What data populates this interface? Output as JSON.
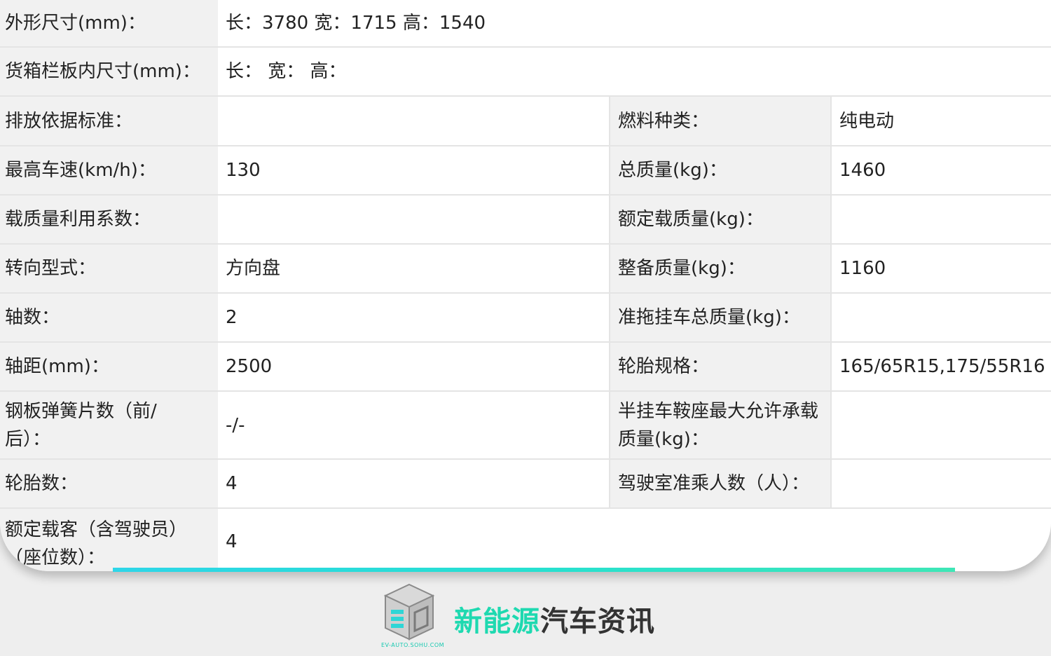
{
  "rows": [
    {
      "label": "外形尺寸(mm)：",
      "value": "长：3780 宽：1715 高：1540"
    },
    {
      "label": "货箱栏板内尺寸(mm)：",
      "value": "长： 宽： 高："
    },
    {
      "label": "排放依据标准：",
      "value": "",
      "label2": "燃料种类：",
      "value2": "纯电动"
    },
    {
      "label": "最高车速(km/h)：",
      "value": "130",
      "label2": "总质量(kg)：",
      "value2": "1460"
    },
    {
      "label": "载质量利用系数：",
      "value": "",
      "label2": "额定载质量(kg)：",
      "value2": ""
    },
    {
      "label": "转向型式：",
      "value": "方向盘",
      "label2": "整备质量(kg)：",
      "value2": "1160"
    },
    {
      "label": "轴数：",
      "value": "2",
      "label2": "准拖挂车总质量(kg)：",
      "value2": ""
    },
    {
      "label": "轴距(mm)：",
      "value": "2500",
      "label2": "轮胎规格：",
      "value2": "165/65R15,175/55R16"
    },
    {
      "label": "钢板弹簧片数（前/后）：",
      "value": "-/-",
      "label2": "半挂车鞍座最大允许承载质量(kg)：",
      "value2": ""
    },
    {
      "label": "轮胎数：",
      "value": "4",
      "label2": "驾驶室准乘人数（人）：",
      "value2": ""
    },
    {
      "label": "额定载客（含驾驶员）（座位数）：",
      "value": "4"
    }
  ],
  "brand": {
    "name_part1": "新能源",
    "name_part2": "汽车资讯",
    "domain": "EV-AUTO.SOHU.COM",
    "logo_icon": "cube-logo-icon",
    "colors": {
      "accent": "#1ed9b0",
      "text": "#333333"
    }
  }
}
